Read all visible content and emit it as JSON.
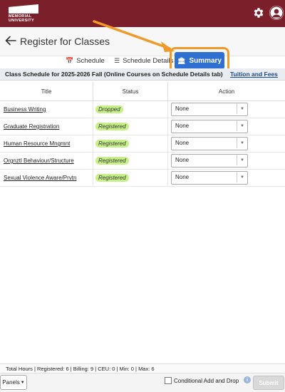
{
  "header": {
    "logo_line1": "MEMORIAL",
    "logo_line2": "UNIVERSITY"
  },
  "page": {
    "title": "Register for Classes"
  },
  "tabs": [
    {
      "label": "Schedule",
      "icon": "calendar-icon"
    },
    {
      "label": "Schedule Details",
      "icon": "list-icon"
    },
    {
      "label": "Summary",
      "icon": "building-icon",
      "active": true
    }
  ],
  "schedule": {
    "heading": "Class Schedule for 2025-2026 Fall (Online Courses on Schedule Details tab)",
    "tuition_link": "Tuition and Fees"
  },
  "table": {
    "columns": [
      "Title",
      "Status",
      "Action"
    ],
    "rows": [
      {
        "title": "Business Writing",
        "status": "Dropped",
        "action": "None"
      },
      {
        "title": "Graduate Registration",
        "status": "Registered",
        "action": "None"
      },
      {
        "title": "Human Resource Mngmnt",
        "status": "Registered",
        "action": "None"
      },
      {
        "title": "Orgnztl Behaviour/Structure",
        "status": "Registered",
        "action": "None"
      },
      {
        "title": "Sexual Violence Aware/Prvtn",
        "status": "Registered",
        "action": "None"
      }
    ]
  },
  "footer": {
    "total_hours": "Total Hours | Registered: 6 | Billing: 9 | CEU: 0 | Min: 0 | Max: 6",
    "panels_label": "Panels",
    "conditional_label": "Conditional Add and Drop",
    "submit_label": "Submit"
  },
  "colors": {
    "brand": "#7b1f2a",
    "accent": "#2f6fd1",
    "registered_badge": "#c8f08a",
    "highlight": "#f19a2a"
  }
}
